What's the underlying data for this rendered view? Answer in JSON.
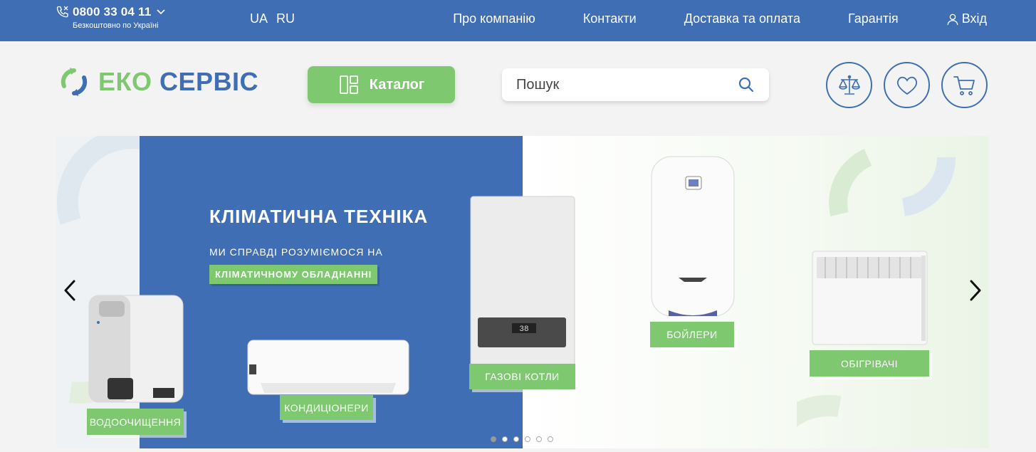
{
  "topbar": {
    "phone": "0800 33 04 11",
    "phone_note": "Безкоштовно по Україні",
    "languages": [
      "UA",
      "RU"
    ],
    "nav": [
      "Про компанію",
      "Контакти",
      "Доставка та оплата",
      "Гарантія"
    ],
    "login_label": "Вхід"
  },
  "header": {
    "logo_eko": "ЕКО",
    "logo_servis": "СЕРВІС",
    "catalog_label": "Каталог",
    "search_placeholder": "Пошук"
  },
  "banner": {
    "title": "КЛІМАТИЧНА ТЕХНІКА",
    "subtitle": "МИ СПРАВДІ РОЗУМІЄМОСЯ НА",
    "highlight": "КЛІМАТИЧНОМУ ОБЛАДНАННІ",
    "categories": [
      "ВОДООЧИЩЕННЯ",
      "КОНДИЦІОНЕРИ",
      "ГАЗОВІ КОТЛИ",
      "БОЙЛЕРИ",
      "ОБІГРІВАЧІ"
    ],
    "boiler_display": "38",
    "slide_count": 6,
    "active_slide": 1
  },
  "colors": {
    "brand_blue": "#3f6eb4",
    "brand_green": "#7ec870",
    "background": "#f3f3f3"
  }
}
